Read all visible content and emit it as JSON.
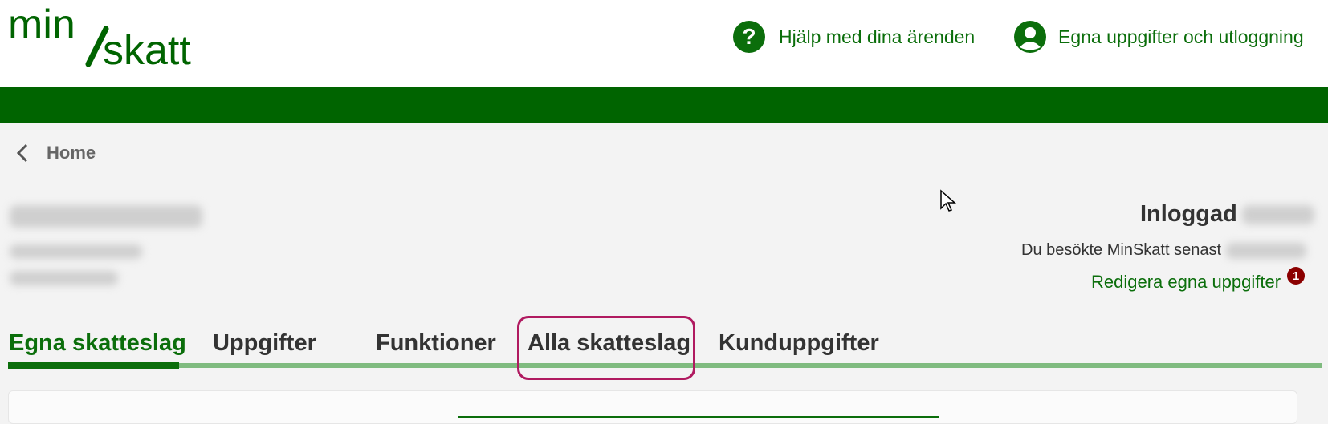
{
  "brand": {
    "logo_text": "min/skatt",
    "green": "#006400",
    "link_green": "#0b6e0b"
  },
  "header": {
    "help_link": {
      "label": "Hjälp med dina ärenden",
      "icon": "question-circle-icon"
    },
    "user_link": {
      "label": "Egna uppgifter och utloggning",
      "icon": "user-circle-icon"
    }
  },
  "breadcrumb": {
    "label": "Home",
    "icon": "chevron-left-icon"
  },
  "user_panel": {
    "login_label": "Inloggad",
    "visit_label": "Du besökte MinSkatt senast",
    "edit_link": "Redigera egna uppgifter",
    "notification_count": "1"
  },
  "tabs": [
    {
      "label": "Egna skatteslag",
      "active": true
    },
    {
      "label": "Uppgifter",
      "active": false
    },
    {
      "label": "Funktioner",
      "active": false
    },
    {
      "label": "Alla skatteslag",
      "active": false,
      "highlighted": true
    },
    {
      "label": "Kunduppgifter",
      "active": false
    }
  ]
}
